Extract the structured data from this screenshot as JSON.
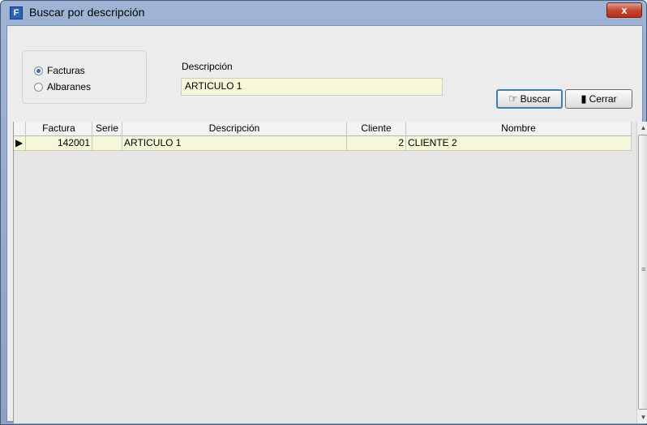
{
  "window": {
    "title": "Buscar por descripción",
    "close_label": "x"
  },
  "filter": {
    "options": [
      {
        "label": "Facturas",
        "selected": true
      },
      {
        "label": "Albaranes",
        "selected": false
      }
    ]
  },
  "search": {
    "label": "Descripción",
    "value": "ARTICULO 1"
  },
  "buttons": {
    "search_label": "Buscar",
    "close_label": "Cerrar"
  },
  "table": {
    "columns": [
      "Factura",
      "Serie",
      "Descripción",
      "Cliente",
      "Nombre"
    ],
    "rows": [
      {
        "factura": "142001",
        "serie": "",
        "descripcion": "ARTICULO 1",
        "cliente": "2",
        "nombre": "CLIENTE 2"
      }
    ]
  },
  "icons": [
    "app-icon",
    "search-icon",
    "exit-icon"
  ]
}
